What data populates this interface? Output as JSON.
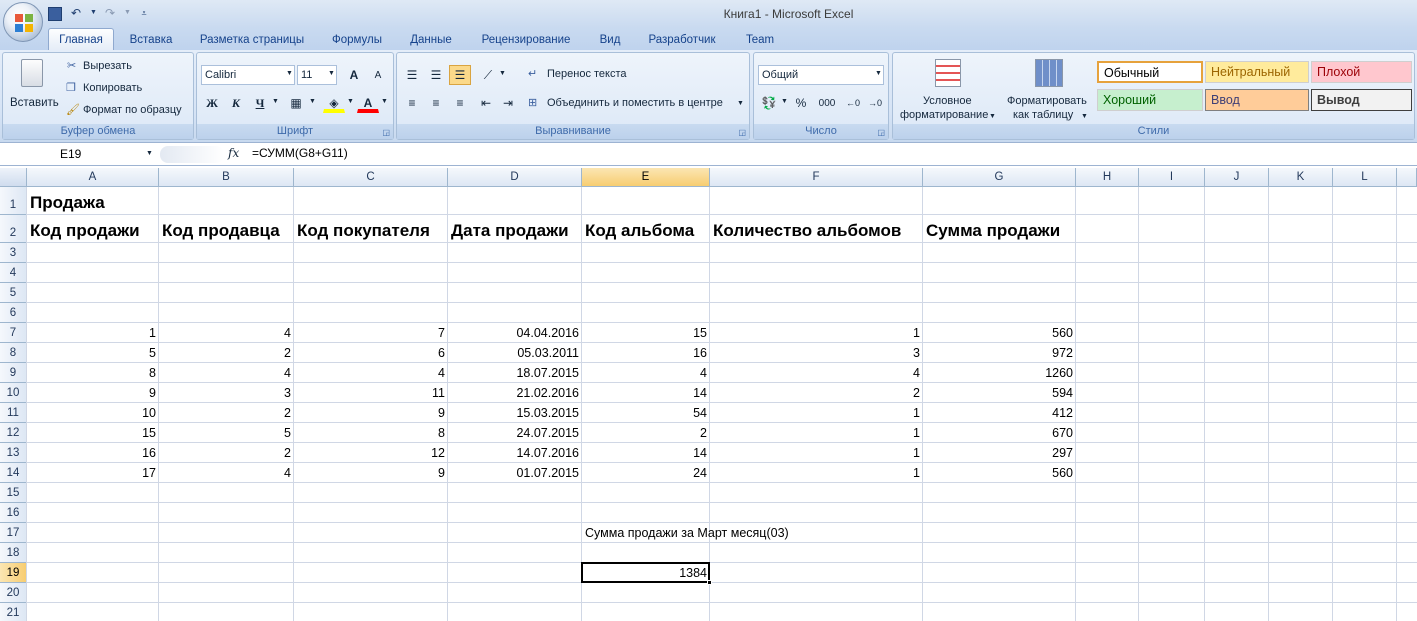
{
  "window": {
    "title": "Книга1 - Microsoft Excel"
  },
  "tabs": [
    "Главная",
    "Вставка",
    "Разметка страницы",
    "Формулы",
    "Данные",
    "Рецензирование",
    "Вид",
    "Разработчик",
    "Team"
  ],
  "active_tab": "Главная",
  "clipboard": {
    "paste": "Вставить",
    "cut": "Вырезать",
    "copy": "Копировать",
    "format_painter": "Формат по образцу",
    "label": "Буфер обмена"
  },
  "font": {
    "name": "Calibri",
    "size": "11",
    "bold": "Ж",
    "italic": "К",
    "underline": "Ч",
    "grow": "A",
    "shrink": "A",
    "color_letter": "A",
    "label": "Шрифт"
  },
  "alignment": {
    "wrap": "Перенос текста",
    "merge": "Объединить и поместить в центре",
    "label": "Выравнивание"
  },
  "number": {
    "format": "Общий",
    "percent": "%",
    "thousands": "000",
    "label": "Число"
  },
  "styles": {
    "conditional": [
      "Условное",
      "форматирование"
    ],
    "as_table": [
      "Форматировать",
      "как таблицу"
    ],
    "cells": [
      "Обычный",
      "Нейтральный",
      "Плохой",
      "Хороший",
      "Ввод",
      "Вывод"
    ],
    "label": "Стили"
  },
  "formula_bar": {
    "name_box": "E19",
    "fx": "fx",
    "formula": "=СУММ(G8+G11)"
  },
  "columns": [
    "A",
    "B",
    "C",
    "D",
    "E",
    "F",
    "G",
    "H",
    "I",
    "J",
    "K",
    "L"
  ],
  "rows": [
    "1",
    "2",
    "3",
    "4",
    "5",
    "6",
    "7",
    "8",
    "9",
    "10",
    "11",
    "12",
    "13",
    "14",
    "15",
    "16",
    "17",
    "18",
    "19",
    "20",
    "21"
  ],
  "sheet": {
    "A1": "Продажа",
    "headers": [
      "Код продажи",
      "Код продавца",
      "Код покупателя",
      "Дата продажи",
      "Код альбома",
      "Количество альбомов",
      "Сумма продажи"
    ],
    "data": [
      [
        "1",
        "4",
        "7",
        "04.04.2016",
        "15",
        "1",
        "560"
      ],
      [
        "5",
        "2",
        "6",
        "05.03.2011",
        "16",
        "3",
        "972"
      ],
      [
        "8",
        "4",
        "4",
        "18.07.2015",
        "4",
        "4",
        "1260"
      ],
      [
        "9",
        "3",
        "11",
        "21.02.2016",
        "14",
        "2",
        "594"
      ],
      [
        "10",
        "2",
        "9",
        "15.03.2015",
        "54",
        "1",
        "412"
      ],
      [
        "15",
        "5",
        "8",
        "24.07.2015",
        "2",
        "1",
        "670"
      ],
      [
        "16",
        "2",
        "12",
        "14.07.2016",
        "14",
        "1",
        "297"
      ],
      [
        "17",
        "4",
        "9",
        "01.07.2015",
        "24",
        "1",
        "560"
      ]
    ],
    "E17": "Сумма продажи за Март месяц(03)",
    "E19": "1384"
  }
}
